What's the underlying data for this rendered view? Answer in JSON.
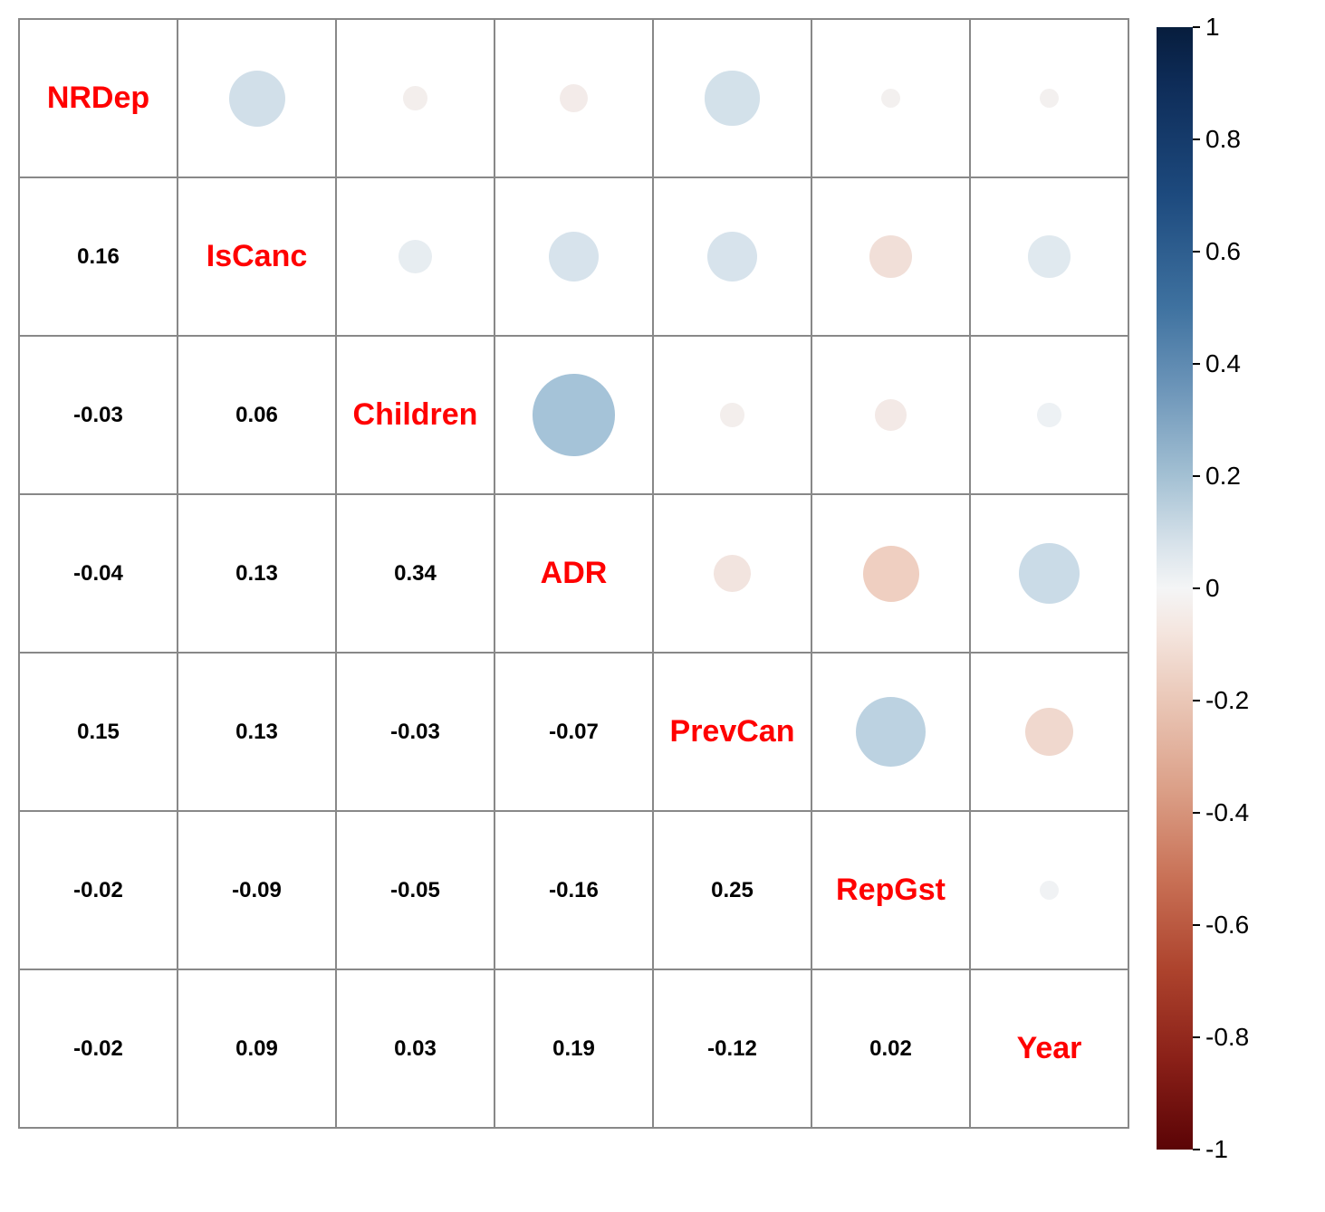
{
  "chart_data": {
    "type": "heatmap",
    "description": "Lower-triangular numeric values, upper-triangular circles colored/sized by correlation, diagonal shows variable names",
    "variables": [
      "NRDep",
      "IsCanc",
      "Children",
      "ADR",
      "PrevCan",
      "RepGst",
      "Year"
    ],
    "matrix": [
      [
        null,
        0.16,
        -0.03,
        -0.04,
        0.15,
        -0.02,
        -0.02
      ],
      [
        0.16,
        null,
        0.06,
        0.13,
        0.13,
        -0.09,
        0.09
      ],
      [
        -0.03,
        0.06,
        null,
        0.34,
        -0.03,
        -0.05,
        0.03
      ],
      [
        -0.04,
        0.13,
        0.34,
        null,
        -0.07,
        -0.16,
        0.19
      ],
      [
        0.15,
        0.13,
        -0.03,
        -0.07,
        null,
        0.25,
        -0.12
      ],
      [
        -0.02,
        -0.09,
        -0.05,
        -0.16,
        0.25,
        null,
        0.02
      ],
      [
        -0.02,
        0.09,
        0.03,
        0.19,
        -0.12,
        0.02,
        null
      ]
    ],
    "colorbar": {
      "min": -1,
      "max": 1,
      "ticks": [
        1,
        0.8,
        0.6,
        0.4,
        0.2,
        0,
        -0.2,
        -0.4,
        -0.6,
        -0.8,
        -1
      ]
    }
  }
}
